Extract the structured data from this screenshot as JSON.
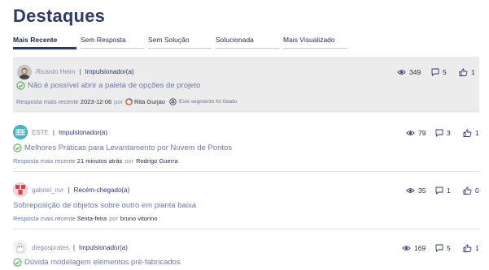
{
  "page": {
    "title": "Destaques"
  },
  "tabs": [
    {
      "label": "Mais Recente",
      "active": true
    },
    {
      "label": "Sem Resposta",
      "active": false
    },
    {
      "label": "Sem Solução",
      "active": false
    },
    {
      "label": "Solucionada",
      "active": false
    },
    {
      "label": "Mais Visualizado",
      "active": false
    }
  ],
  "posts": [
    {
      "author": "Ricardo Heim",
      "role": "Impulsionador(a)",
      "title": "Não é possível abrir a paleta de opções de projeto",
      "solved": true,
      "reply_label": "Resposta mais recente",
      "reply_time": "2023-12-06",
      "reply_by": "por",
      "reply_author": "Rita Gurjao",
      "pinned_note": "Este segmento foi fixado",
      "views": "349",
      "comments": "5",
      "likes": "1"
    },
    {
      "author": "ESTE",
      "role": "Impulsionador(a)",
      "title": "Melhores Práticas para Levantamento por Nuvem de Pontos",
      "solved": true,
      "reply_label": "Resposta mais recente",
      "reply_time": "21 minutos atrás",
      "reply_by": "por",
      "reply_author": "Rodrigo Guerra",
      "views": "79",
      "comments": "3",
      "likes": "1"
    },
    {
      "author": "gabriel_nvr",
      "role": "Recém-chegado(a)",
      "title": "Sobreposição de objetos sobre outro em planta baixa",
      "solved": false,
      "reply_label": "Resposta mais recente",
      "reply_time": "Sexta-feira",
      "reply_by": "por",
      "reply_author": "bruno vitorino",
      "views": "35",
      "comments": "1",
      "likes": "0"
    },
    {
      "author": "diegosprates",
      "role": "Impulsionador(a)",
      "title": "Dúvida modelagem elementos pré-fabricados",
      "solved": true,
      "views": "169",
      "comments": "5",
      "likes": "1"
    }
  ],
  "colors": {
    "heading": "#2f3a6b",
    "link": "#6f79a8",
    "solved_check": "#4caf50",
    "pinned_bg": "#ececec"
  }
}
